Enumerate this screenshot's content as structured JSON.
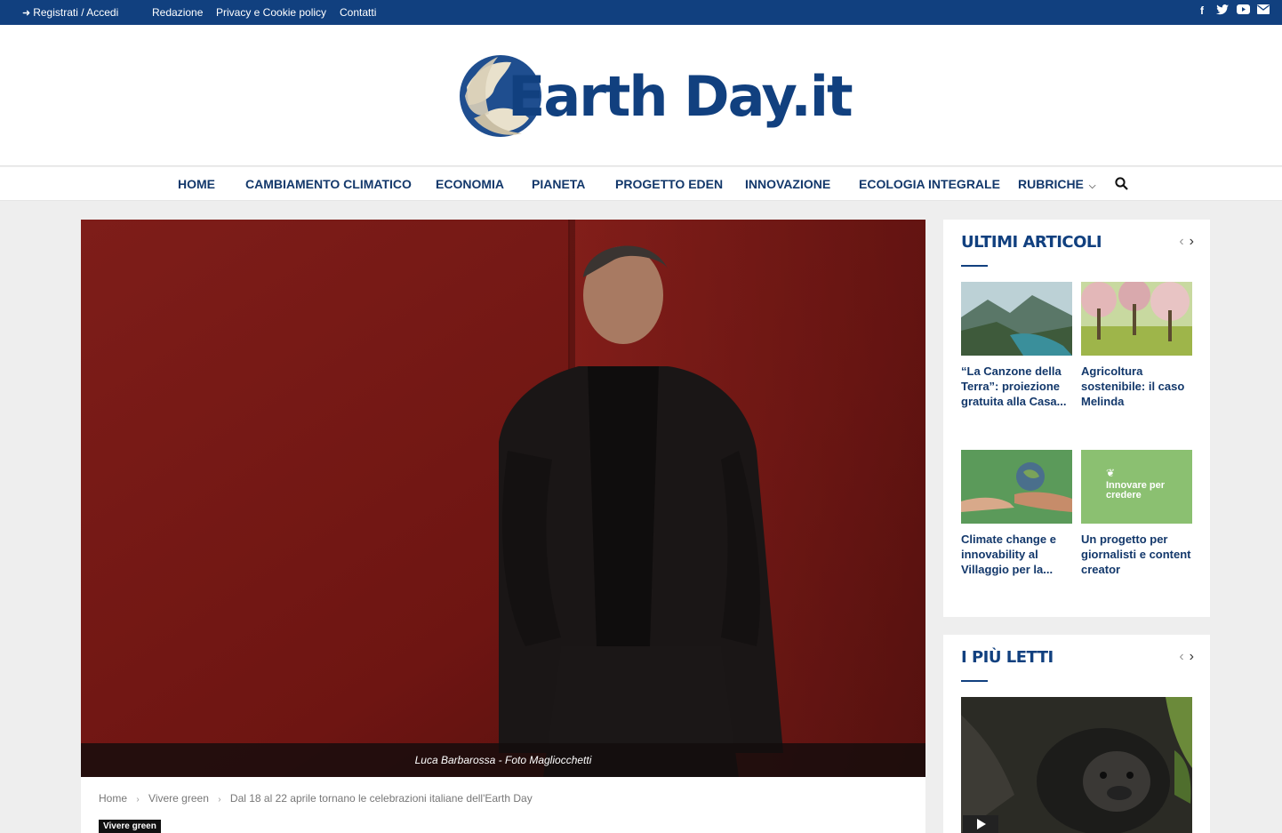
{
  "topbar": {
    "login": "Registrati / Accedi",
    "links": [
      "Redazione",
      "Privacy e Cookie policy",
      "Contatti"
    ],
    "social_icons": [
      "facebook-icon",
      "twitter-icon",
      "youtube-icon",
      "email-icon"
    ]
  },
  "header": {
    "logo_text": "Earth Day.it"
  },
  "nav": {
    "items": [
      "HOME",
      "CAMBIAMENTO CLIMATICO",
      "ECONOMIA",
      "PIANETA",
      "PROGETTO EDEN",
      "INNOVAZIONE",
      "ECOLOGIA INTEGRALE",
      "RUBRICHE"
    ],
    "search_icon": "search-icon"
  },
  "hero": {
    "caption": "Luca Barbarossa - Foto Magliocchetti"
  },
  "breadcrumb": {
    "home": "Home",
    "category": "Vivere green",
    "current": "Dal 18 al 22 aprile tornano le celebrazioni italiane dell'Earth Day"
  },
  "article": {
    "tag": "Vivere green"
  },
  "widgets": {
    "latest": {
      "title": "ULTIMI ARTICOLI",
      "cards": [
        {
          "title": "“La Canzone della Terra”: proiezione gratuita alla Casa..."
        },
        {
          "title": "Agricoltura sostenibile: il caso Melinda"
        },
        {
          "title": "Climate change e innovability al Villaggio per la..."
        },
        {
          "title": "Un progetto per giornalisti e content creator"
        }
      ],
      "promo_text": "Innovare per credere"
    },
    "most_read": {
      "title": "I PIÙ LETTI"
    }
  },
  "colors": {
    "brand_blue": "#11407f",
    "hero_red": "#7a1a17",
    "promo_green": "#8bc071"
  }
}
